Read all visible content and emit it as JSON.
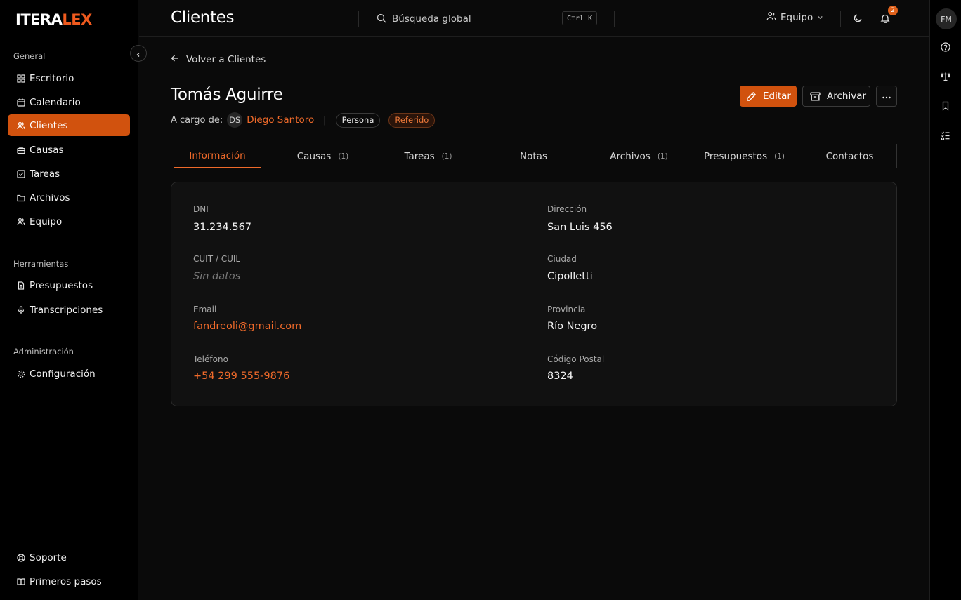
{
  "brand": {
    "logo_part1": "ITERA",
    "logo_part2": "LEX"
  },
  "sidebar": {
    "sections": [
      {
        "label": "General",
        "items": [
          {
            "label": "Escritorio",
            "icon": "dashboard-icon"
          },
          {
            "label": "Calendario",
            "icon": "calendar-icon"
          },
          {
            "label": "Clientes",
            "icon": "users-icon",
            "active": true
          },
          {
            "label": "Causas",
            "icon": "briefcase-icon"
          },
          {
            "label": "Tareas",
            "icon": "checkbox-icon"
          },
          {
            "label": "Archivos",
            "icon": "folder-icon"
          },
          {
            "label": "Equipo",
            "icon": "team-icon"
          }
        ]
      },
      {
        "label": "Herramientas",
        "items": [
          {
            "label": "Presupuestos",
            "icon": "document-icon"
          },
          {
            "label": "Transcripciones",
            "icon": "microphone-icon"
          }
        ]
      },
      {
        "label": "Administración",
        "items": [
          {
            "label": "Configuración",
            "icon": "gear-icon"
          }
        ]
      }
    ],
    "footer": [
      {
        "label": "Soporte",
        "icon": "lifebuoy-icon"
      },
      {
        "label": "Primeros pasos",
        "icon": "book-icon"
      }
    ]
  },
  "header": {
    "title": "Clientes",
    "search_placeholder": "Búsqueda global",
    "shortcut": "Ctrl K",
    "team_label": "Equipo",
    "notification_count": "2"
  },
  "user": {
    "initials": "FM"
  },
  "client": {
    "back_label": "Volver a Clientes",
    "name": "Tomás Aguirre",
    "assigned_label": "A cargo de:",
    "owner_initials": "DS",
    "owner_name": "Diego Santoro",
    "separator": "|",
    "tags": [
      "Persona",
      "Referido"
    ]
  },
  "actions": {
    "edit": "Editar",
    "archive": "Archivar"
  },
  "tabs": [
    {
      "label": "Información",
      "count": "",
      "active": true
    },
    {
      "label": "Causas",
      "count": "(1)"
    },
    {
      "label": "Tareas",
      "count": "(1)"
    },
    {
      "label": "Notas",
      "count": ""
    },
    {
      "label": "Archivos",
      "count": "(1)"
    },
    {
      "label": "Presupuestos",
      "count": "(1)"
    },
    {
      "label": "Contactos",
      "count": ""
    }
  ],
  "fields": {
    "dni": {
      "label": "DNI",
      "value": "31.234.567"
    },
    "cuit": {
      "label": "CUIT / CUIL",
      "value": "Sin datos"
    },
    "email": {
      "label": "Email",
      "value": "fandreoli@gmail.com"
    },
    "phone": {
      "label": "Teléfono",
      "value": "+54 299 555-9876"
    },
    "address": {
      "label": "Dirección",
      "value": "San Luis 456"
    },
    "city": {
      "label": "Ciudad",
      "value": "Cipolletti"
    },
    "province": {
      "label": "Provincia",
      "value": "Río Negro"
    },
    "postal": {
      "label": "Código Postal",
      "value": "8324"
    }
  },
  "colors": {
    "accent": "#d1520e",
    "accent_text": "#ef6a2a",
    "background": "#0a0a0a",
    "card": "#111111"
  }
}
